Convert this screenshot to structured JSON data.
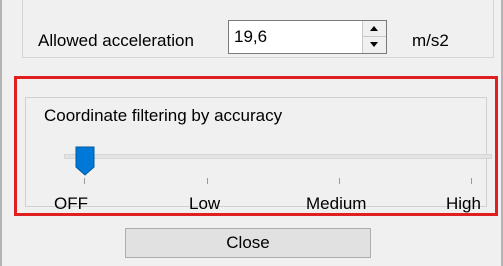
{
  "acceleration": {
    "label": "Allowed acceleration",
    "value": "19,6",
    "unit": "m/s2"
  },
  "filtering": {
    "title": "Coordinate filtering by accuracy",
    "levels": [
      "OFF",
      "Low",
      "Medium",
      "High"
    ],
    "selected": "OFF",
    "selected_index": 0
  },
  "highlight_color": "#e02020",
  "close_label": "Close",
  "icons": {
    "spin_up": "triangle-up-icon",
    "spin_down": "triangle-down-icon",
    "slider_thumb": "slider-thumb-icon"
  }
}
